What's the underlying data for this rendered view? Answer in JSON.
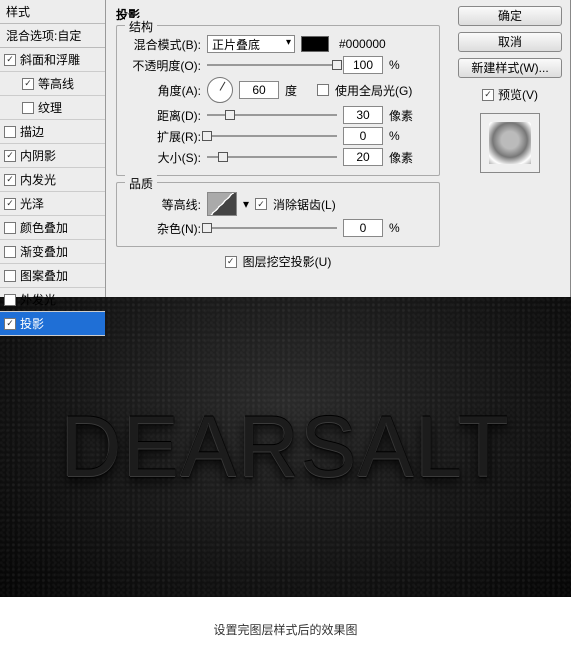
{
  "sidebar": {
    "title": "样式",
    "sub": "混合选项:自定",
    "items": [
      {
        "label": "斜面和浮雕",
        "checked": true
      },
      {
        "label": "等高线",
        "checked": true,
        "child": true
      },
      {
        "label": "纹理",
        "checked": false,
        "child": true
      },
      {
        "label": "描边",
        "checked": false
      },
      {
        "label": "内阴影",
        "checked": true
      },
      {
        "label": "内发光",
        "checked": true
      },
      {
        "label": "光泽",
        "checked": true
      },
      {
        "label": "颜色叠加",
        "checked": false
      },
      {
        "label": "渐变叠加",
        "checked": false
      },
      {
        "label": "图案叠加",
        "checked": false
      },
      {
        "label": "外发光",
        "checked": false
      },
      {
        "label": "投影",
        "checked": true,
        "selected": true
      }
    ]
  },
  "panel": {
    "title": "投影",
    "structure": "结构",
    "blend_label": "混合模式(B):",
    "blend_value": "正片叠底",
    "color": "#000000",
    "opacity_label": "不透明度(O):",
    "opacity_value": "100",
    "opacity_unit": "%",
    "angle_label": "角度(A):",
    "angle_value": "60",
    "angle_unit": "度",
    "global_label": "使用全局光(G)",
    "dist_label": "距离(D):",
    "dist_value": "30",
    "dist_unit": "像素",
    "spread_label": "扩展(R):",
    "spread_value": "0",
    "spread_unit": "%",
    "size_label": "大小(S):",
    "size_value": "20",
    "size_unit": "像素",
    "quality": "品质",
    "contour_label": "等高线:",
    "aa_label": "消除锯齿(L)",
    "noise_label": "杂色(N):",
    "noise_value": "0",
    "noise_unit": "%",
    "knockout_label": "图层挖空投影(U)"
  },
  "right": {
    "ok": "确定",
    "cancel": "取消",
    "newstyle": "新建样式(W)...",
    "preview": "预览(V)"
  },
  "result_text": "DEARSALT",
  "caption": "设置完图层样式后的效果图"
}
